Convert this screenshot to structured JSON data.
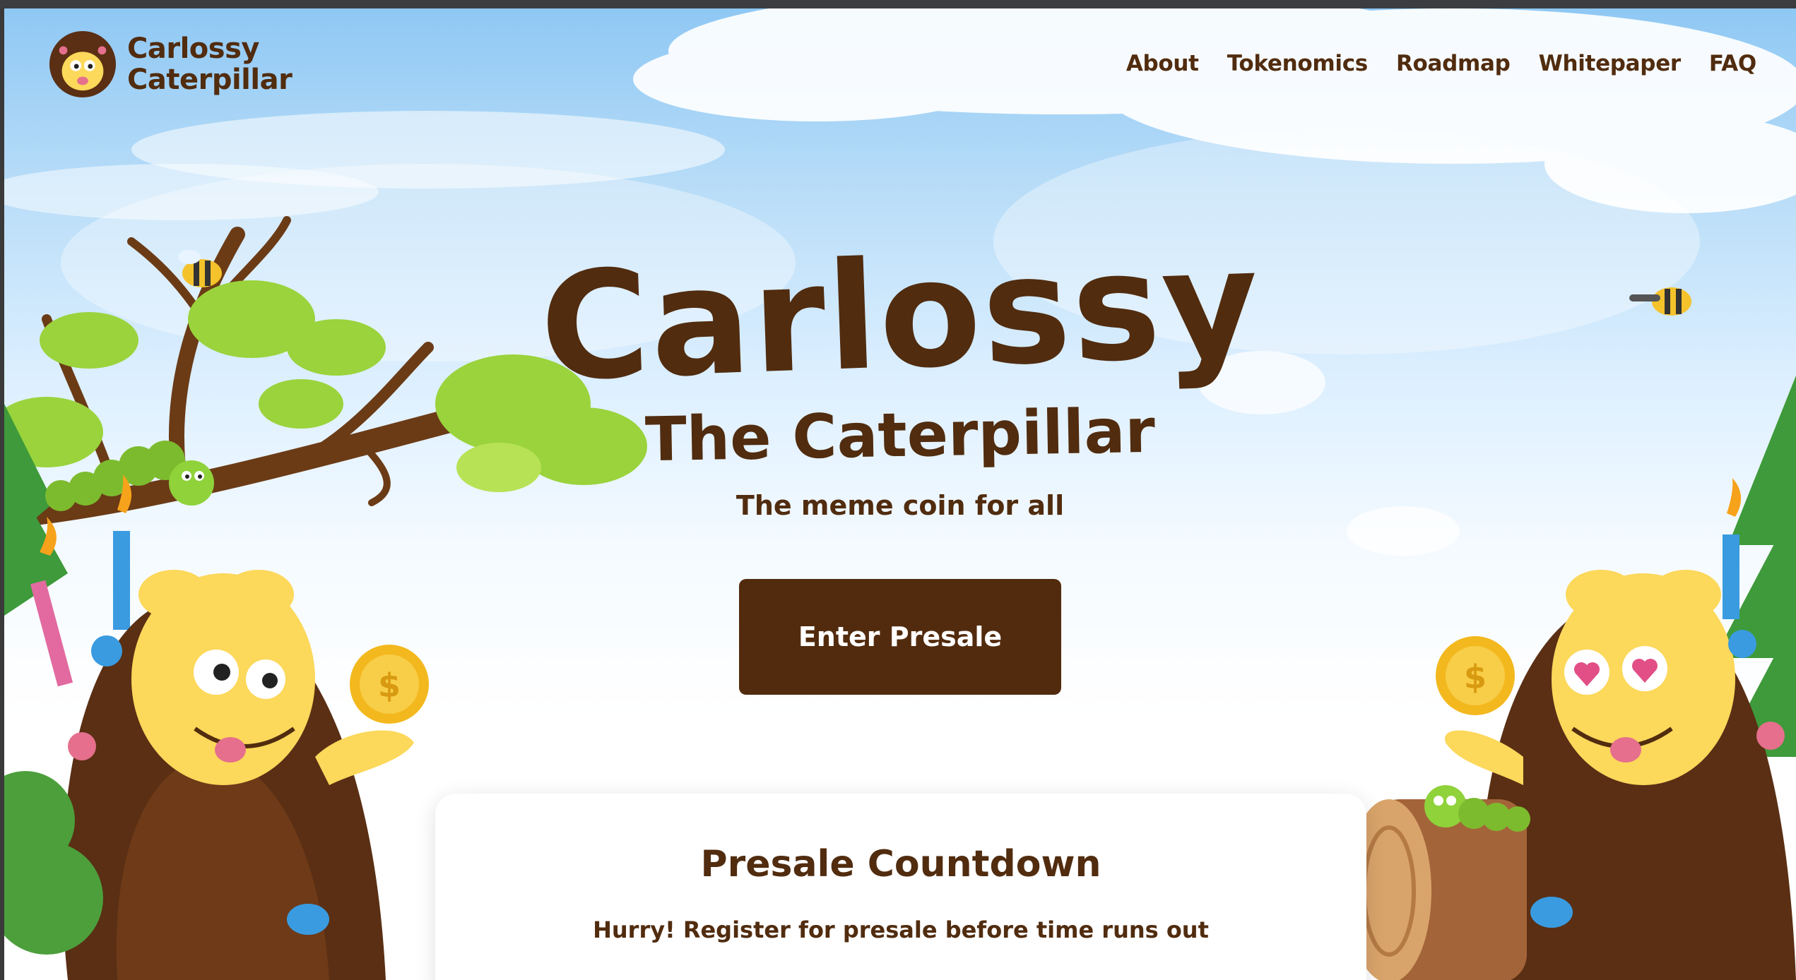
{
  "brand": {
    "name_line1": "Carlossy",
    "name_line2": "Caterpillar",
    "logo_icon": "caterpillar-face-icon"
  },
  "nav": {
    "items": [
      {
        "label": "About"
      },
      {
        "label": "Tokenomics"
      },
      {
        "label": "Roadmap"
      },
      {
        "label": "Whitepaper"
      },
      {
        "label": "FAQ"
      }
    ]
  },
  "hero": {
    "title": "Carlossy",
    "subtitle": "The Caterpillar",
    "tagline": "The meme coin for all",
    "cta_label": "Enter Presale"
  },
  "presale_card": {
    "title": "Presale Countdown",
    "subtitle": "Hurry! Register for presale before time runs out"
  },
  "colors": {
    "brand_brown": "#512c0f",
    "button_brown": "#522b0e",
    "sky_blue": "#8fc8f4",
    "leaf_green": "#9ad33c",
    "mascot_yellow": "#fcd85b"
  }
}
